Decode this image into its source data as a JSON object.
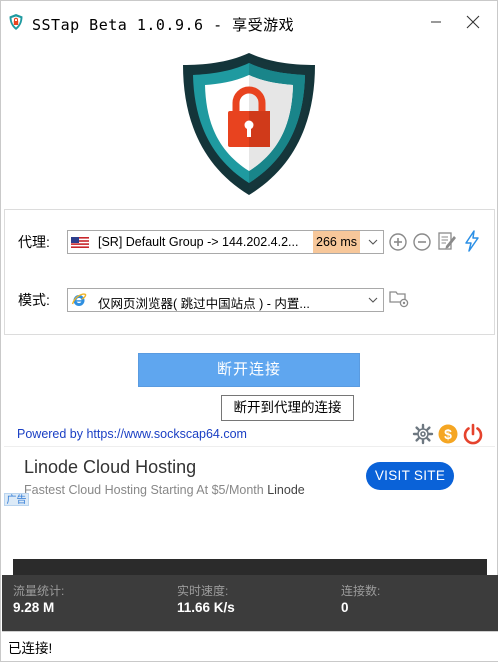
{
  "window": {
    "title": "SSTap Beta 1.0.9.6 - 享受游戏"
  },
  "proxy": {
    "label": "代理:",
    "selected": "[SR] Default Group -> 144.202.4.2...",
    "ping": "266 ms",
    "flag_icon": "us-flag-icon"
  },
  "mode": {
    "label": "模式:",
    "selected": "仅网页浏览器( 跳过中国站点 ) - 内置...",
    "icon": "browser-icon"
  },
  "connect": {
    "button_label": "断开连接",
    "tooltip": "断开到代理的连接"
  },
  "powered_by": "Powered by https://www.sockscap64.com",
  "ad": {
    "title": "Linode Cloud Hosting",
    "subtitle": "Fastest Cloud Hosting Starting At $5/Month",
    "brand": "Linode",
    "cta": "VISIT SITE",
    "tag": "广告"
  },
  "stats": {
    "traffic_label": "流量统计:",
    "traffic_value": "9.28 M",
    "speed_label": "实时速度:",
    "speed_value": "11.66 K/s",
    "connections_label": "连接数:",
    "connections_value": "0"
  },
  "status": {
    "text": "已连接!"
  },
  "colors": {
    "shield_teal": "#1f9aa0",
    "shield_dark": "#14353a",
    "lock_red": "#e8431f",
    "connect_button": "#5fa6ef",
    "ping_highlight": "#f7c79a",
    "ad_button": "#0a62d8",
    "stats_bg": "#3c3c3c"
  }
}
